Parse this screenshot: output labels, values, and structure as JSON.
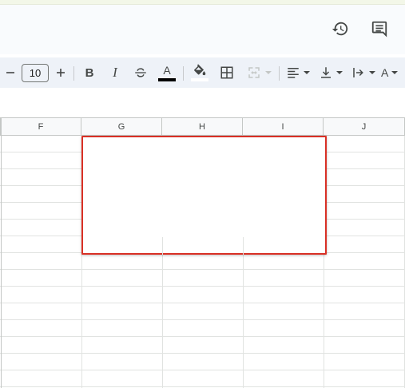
{
  "header": {
    "icons": [
      "history-icon",
      "comments-icon"
    ]
  },
  "toolbar": {
    "font_size": "10",
    "bold_label": "B",
    "italic_label": "I",
    "text_color_label": "A",
    "text_color": "#000000",
    "rotate_label": "A"
  },
  "sheet": {
    "columns": [
      "F",
      "G",
      "H",
      "I",
      "J"
    ],
    "selection_color": "#d93025"
  }
}
